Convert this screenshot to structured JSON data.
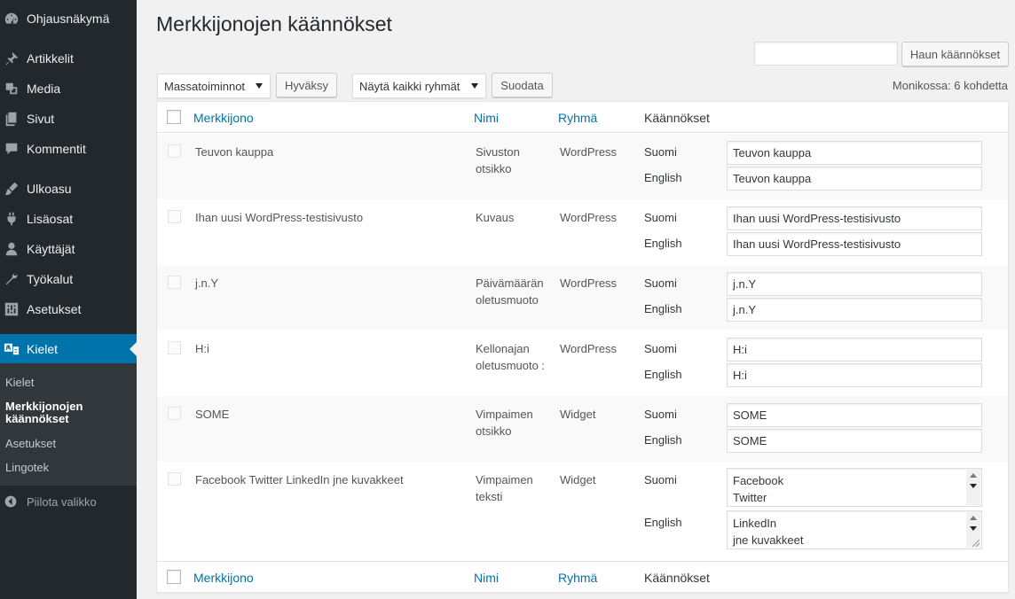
{
  "sidebar": {
    "items": [
      {
        "label": "Ohjausnäkymä",
        "icon": "dashboard-icon"
      },
      {
        "label": "Artikkelit",
        "icon": "pin-icon"
      },
      {
        "label": "Media",
        "icon": "media-icon"
      },
      {
        "label": "Sivut",
        "icon": "pages-icon"
      },
      {
        "label": "Kommentit",
        "icon": "comment-icon"
      },
      {
        "label": "Ulkoasu",
        "icon": "brush-icon"
      },
      {
        "label": "Lisäosat",
        "icon": "plugin-icon"
      },
      {
        "label": "Käyttäjät",
        "icon": "users-icon"
      },
      {
        "label": "Työkalut",
        "icon": "wrench-icon"
      },
      {
        "label": "Asetukset",
        "icon": "settings-icon"
      },
      {
        "label": "Kielet",
        "icon": "translate-icon"
      }
    ],
    "submenu": [
      {
        "label": "Kielet"
      },
      {
        "label": "Merkkijonojen käännökset"
      },
      {
        "label": "Asetukset"
      },
      {
        "label": "Lingotek"
      }
    ],
    "collapse_label": "Piilota valikko",
    "colors": {
      "background": "#23282d",
      "active": "#0073aa",
      "submenu": "#32373c"
    }
  },
  "page": {
    "title": "Merkkijonojen käännökset",
    "search_placeholder": "",
    "search_button": "Haun käännökset",
    "bulk_select": "Massatoiminnot",
    "apply_button": "Hyväksy",
    "group_select": "Näytä kaikki ryhmät",
    "filter_button": "Suodata",
    "item_count": "Monikossa: 6 kohdetta"
  },
  "table": {
    "columns": {
      "string": "Merkkijono",
      "name": "Nimi",
      "group": "Ryhmä",
      "translations": "Käännökset"
    },
    "rows": [
      {
        "string": "Teuvon kauppa",
        "name": "Sivuston otsikko",
        "group": "WordPress",
        "translations": [
          {
            "lang": "Suomi",
            "value": "Teuvon kauppa"
          },
          {
            "lang": "English",
            "value": "Teuvon kauppa"
          }
        ]
      },
      {
        "string": "Ihan uusi WordPress-testisivusto",
        "name": "Kuvaus",
        "group": "WordPress",
        "translations": [
          {
            "lang": "Suomi",
            "value": "Ihan uusi WordPress-testisivusto"
          },
          {
            "lang": "English",
            "value": "Ihan uusi WordPress-testisivusto"
          }
        ]
      },
      {
        "string": "j.n.Y",
        "name": "Päivämäärän oletusmuoto",
        "group": "WordPress",
        "translations": [
          {
            "lang": "Suomi",
            "value": "j.n.Y"
          },
          {
            "lang": "English",
            "value": "j.n.Y"
          }
        ]
      },
      {
        "string": "H:i",
        "name": "Kellonajan oletusmuoto :",
        "group": "WordPress",
        "translations": [
          {
            "lang": "Suomi",
            "value": "H:i"
          },
          {
            "lang": "English",
            "value": "H:i"
          }
        ]
      },
      {
        "string": "SOME",
        "name": "Vimpaimen otsikko",
        "group": "Widget",
        "translations": [
          {
            "lang": "Suomi",
            "value": "SOME"
          },
          {
            "lang": "English",
            "value": "SOME"
          }
        ]
      },
      {
        "string": "Facebook Twitter LinkedIn jne kuvakkeet",
        "name": "Vimpaimen teksti",
        "group": "Widget",
        "translations": [
          {
            "lang": "Suomi",
            "value": "Facebook\nTwitter"
          },
          {
            "lang": "English",
            "value": "LinkedIn\njne kuvakkeet"
          }
        ]
      }
    ]
  }
}
